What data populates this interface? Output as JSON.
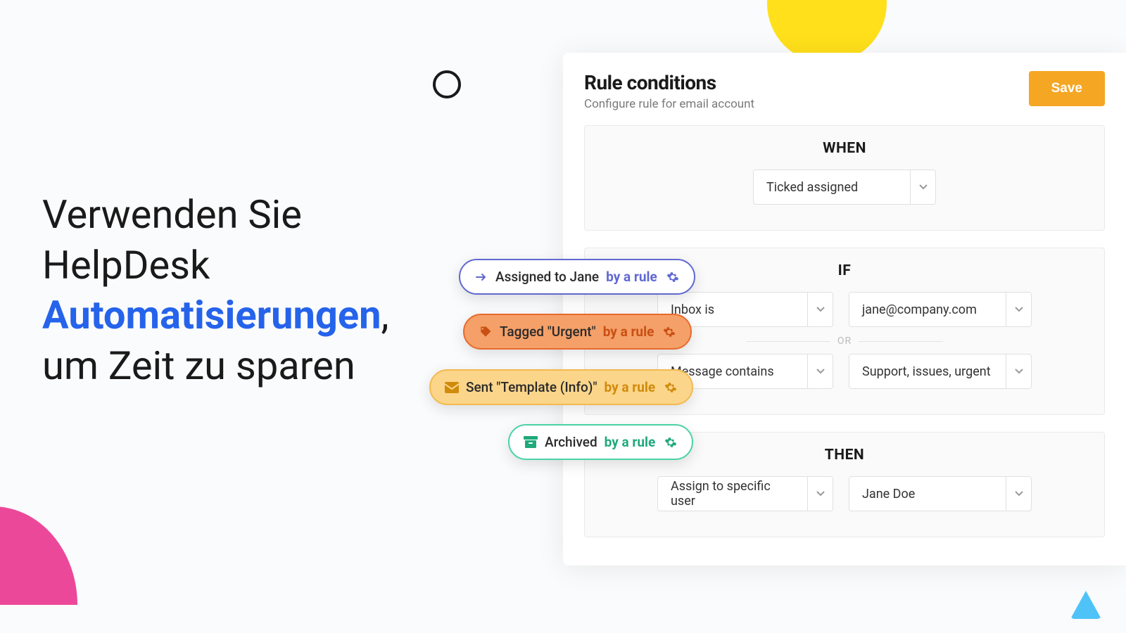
{
  "headline": {
    "line1": "Verwenden Sie",
    "line2": "HelpDesk",
    "highlight": "Automatisierungen",
    "comma": ",",
    "line3": "um Zeit zu sparen"
  },
  "panel": {
    "title": "Rule conditions",
    "subtitle": "Configure rule for email account",
    "save": "Save",
    "sections": {
      "when": {
        "label": "WHEN",
        "trigger": "Ticked assigned"
      },
      "if": {
        "label": "IF",
        "or": "OR",
        "rows": [
          {
            "field": "Inbox is",
            "value": "jane@company.com"
          },
          {
            "field": "Message contains",
            "value": "Support, issues, urgent"
          }
        ]
      },
      "then": {
        "label": "THEN",
        "action": "Assign to specific user",
        "target": "Jane Doe"
      }
    }
  },
  "chips": {
    "assigned": {
      "text": "Assigned to Jane",
      "by": "by a rule"
    },
    "tagged": {
      "text": "Tagged \"Urgent\"",
      "by": "by a rule"
    },
    "sent": {
      "text": "Sent \"Template (Info)\"",
      "by": "by a rule"
    },
    "archived": {
      "text": "Archived",
      "by": "by a rule"
    }
  }
}
